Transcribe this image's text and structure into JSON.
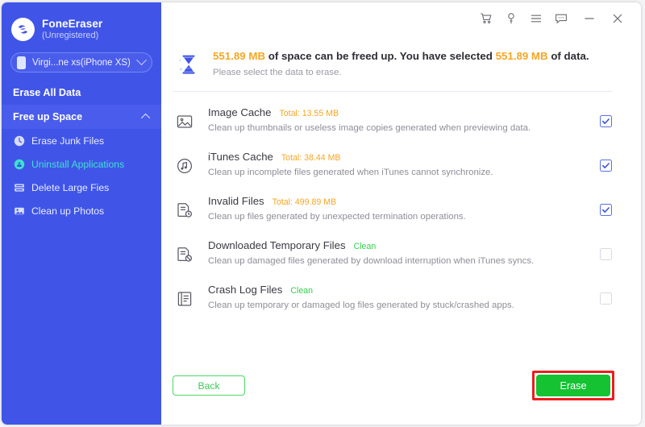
{
  "brand": {
    "name": "FoneEraser",
    "status": "(Unregistered)",
    "logo_icon": "foneeraser-logo-icon"
  },
  "device": {
    "label": "Virgi...ne xs(iPhone XS)",
    "icon": "phone-icon",
    "chevron": "chevron-down-icon"
  },
  "sidebar": {
    "erase_all_data": "Erase All Data",
    "free_up_space": "Free up Space",
    "collapse_icon": "chevron-up-icon",
    "items": [
      {
        "label": "Erase Junk Files",
        "icon": "clock-icon",
        "selected": false
      },
      {
        "label": "Uninstall Applications",
        "icon": "apps-circle-icon",
        "selected": true
      },
      {
        "label": "Delete Large Fies",
        "icon": "rows-icon",
        "selected": false
      },
      {
        "label": "Clean up Photos",
        "icon": "photo-icon",
        "selected": false
      }
    ]
  },
  "titlebar": {
    "buttons": [
      {
        "name": "cart-icon",
        "title": "Cart"
      },
      {
        "name": "key-icon",
        "title": "Register"
      },
      {
        "name": "menu-icon",
        "title": "Menu"
      },
      {
        "name": "feedback-chat-icon",
        "title": "Feedback"
      },
      {
        "name": "minimize-icon",
        "title": "Minimize"
      },
      {
        "name": "close-icon",
        "title": "Close"
      }
    ]
  },
  "banner": {
    "icon": "hourglass-icon",
    "freeable_size": "551.89 MB",
    "selected_size": "551.89 MB",
    "text_part_1": "of space can be freed up. You have selected",
    "text_part_2": "of data.",
    "subtitle": "Please select the data to erase.",
    "amount_color": "#f5a623"
  },
  "list": {
    "items": [
      {
        "icon": "image-cache-icon",
        "title": "Image Cache",
        "total": "Total: 13.55 MB",
        "total_state": "size",
        "desc": "Clean up thumbnails or useless image copies generated when previewing data.",
        "checked": true
      },
      {
        "icon": "itunes-music-icon",
        "title": "iTunes Cache",
        "total": "Total: 38.44 MB",
        "total_state": "size",
        "desc": "Clean up incomplete files generated when iTunes cannot synchronize.",
        "checked": true
      },
      {
        "icon": "invalid-file-clock-icon",
        "title": "Invalid Files",
        "total": "Total: 499.89 MB",
        "total_state": "size",
        "desc": "Clean up files generated by unexpected termination operations.",
        "checked": true
      },
      {
        "icon": "blocked-file-icon",
        "title": "Downloaded Temporary Files",
        "total": "Clean",
        "total_state": "clean",
        "desc": "Clean up damaged files generated by download interruption when iTunes syncs.",
        "checked": false
      },
      {
        "icon": "log-file-icon",
        "title": "Crash Log Files",
        "total": "Clean",
        "total_state": "clean",
        "desc": "Clean up temporary or damaged log files generated by stuck/crashed apps.",
        "checked": false
      }
    ]
  },
  "footer": {
    "back_label": "Back",
    "erase_label": "Erase",
    "highlight_color": "#ee1c1c",
    "erase_color": "#14c232",
    "back_border_color": "#4cd964"
  }
}
